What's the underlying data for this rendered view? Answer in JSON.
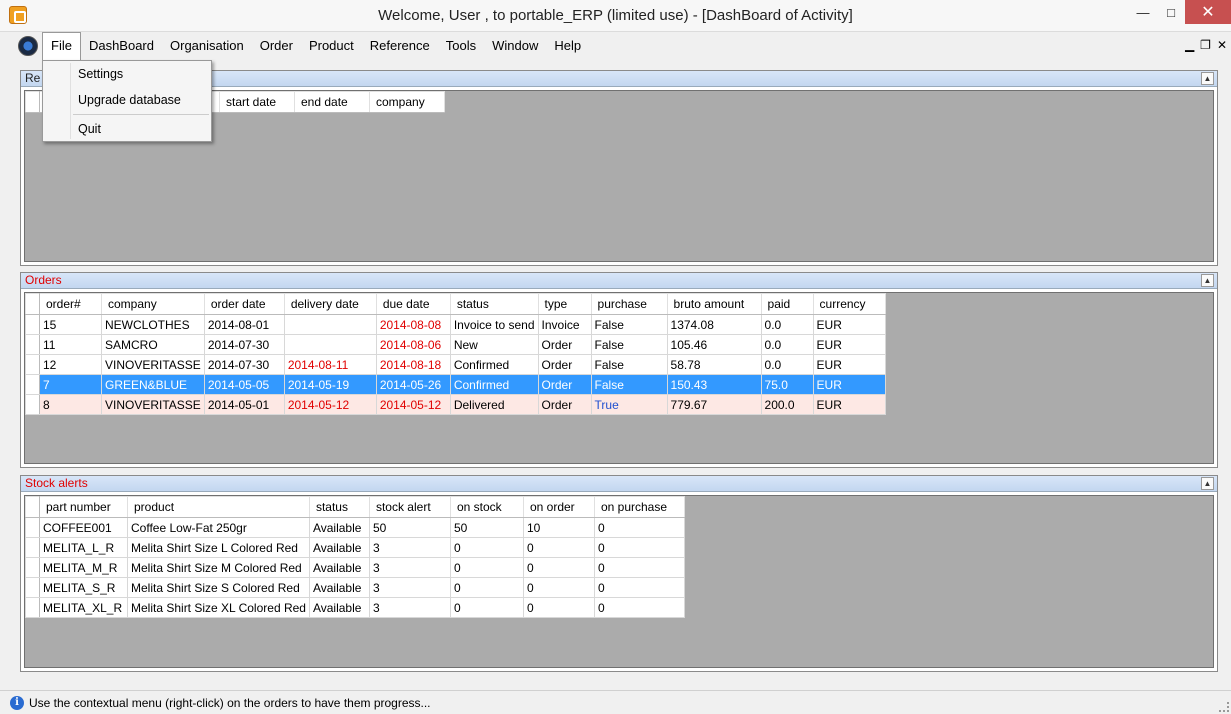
{
  "window": {
    "title": "Welcome, User , to portable_ERP (limited use) - [DashBoard of Activity]",
    "minimize": "—",
    "maximize": "□",
    "close": "✕"
  },
  "menubar": {
    "items": [
      "File",
      "DashBoard",
      "Organisation",
      "Order",
      "Product",
      "Reference",
      "Tools",
      "Window",
      "Help"
    ],
    "mdi_minimize": "▁",
    "mdi_restore": "❐",
    "mdi_close": "✕"
  },
  "file_menu": {
    "items": [
      "Settings",
      "Upgrade database",
      "Quit"
    ]
  },
  "reminders_panel": {
    "title_fragment": "Re",
    "columns": [
      "start date",
      "end date",
      "company"
    ]
  },
  "orders_panel": {
    "title": "Orders",
    "columns": [
      "order#",
      "company",
      "order date",
      "delivery date",
      "due date",
      "status",
      "type",
      "purchase",
      "bruto amount",
      "paid",
      "currency"
    ],
    "rows": [
      {
        "order": "15",
        "company": "NEWCLOTHES",
        "order_date": "2014-08-01",
        "delivery_date": "",
        "due_date": "2014-08-08",
        "status": "Invoice to send",
        "type": "Invoice",
        "purchase": "False",
        "bruto": "1374.08",
        "paid": "0.0",
        "currency": "EUR"
      },
      {
        "order": "11",
        "company": "SAMCRO",
        "order_date": "2014-07-30",
        "delivery_date": "",
        "due_date": "2014-08-06",
        "status": "New",
        "type": "Order",
        "purchase": "False",
        "bruto": "105.46",
        "paid": "0.0",
        "currency": "EUR"
      },
      {
        "order": "12",
        "company": "VINOVERITASSE",
        "order_date": "2014-07-30",
        "delivery_date": "2014-08-11",
        "due_date": "2014-08-18",
        "status": "Confirmed",
        "type": "Order",
        "purchase": "False",
        "bruto": "58.78",
        "paid": "0.0",
        "currency": "EUR"
      },
      {
        "order": "7",
        "company": "GREEN&BLUE",
        "order_date": "2014-05-05",
        "delivery_date": "2014-05-19",
        "due_date": "2014-05-26",
        "status": "Confirmed",
        "type": "Order",
        "purchase": "False",
        "bruto": "150.43",
        "paid": "75.0",
        "currency": "EUR"
      },
      {
        "order": "8",
        "company": "VINOVERITASSE",
        "order_date": "2014-05-01",
        "delivery_date": "2014-05-12",
        "due_date": "2014-05-12",
        "status": "Delivered",
        "type": "Order",
        "purchase": "True",
        "bruto": "779.67",
        "paid": "200.0",
        "currency": "EUR"
      }
    ]
  },
  "stock_panel": {
    "title": "Stock alerts",
    "columns": [
      "part number",
      "product",
      "status",
      "stock alert",
      "on stock",
      "on order",
      "on purchase"
    ],
    "rows": [
      {
        "part": "COFFEE001",
        "product": "Coffee Low-Fat 250gr",
        "status": "Available",
        "alert": "50",
        "stock": "50",
        "order": "10",
        "purchase": "0"
      },
      {
        "part": "MELITA_L_R",
        "product": "Melita Shirt Size L Colored Red",
        "status": "Available",
        "alert": "3",
        "stock": "0",
        "order": "0",
        "purchase": "0"
      },
      {
        "part": "MELITA_M_R",
        "product": "Melita Shirt Size M Colored Red",
        "status": "Available",
        "alert": "3",
        "stock": "0",
        "order": "0",
        "purchase": "0"
      },
      {
        "part": "MELITA_S_R",
        "product": "Melita Shirt Size S Colored Red",
        "status": "Available",
        "alert": "3",
        "stock": "0",
        "order": "0",
        "purchase": "0"
      },
      {
        "part": "MELITA_XL_R",
        "product": "Melita Shirt Size XL Colored Red",
        "status": "Available",
        "alert": "3",
        "stock": "0",
        "order": "0",
        "purchase": "0"
      }
    ]
  },
  "statusbar": {
    "info_glyph": "i",
    "text": "Use the contextual menu (right-click) on the orders to have them progress..."
  },
  "colors": {
    "overdue_red": "#e00000",
    "selection_blue": "#3399ff",
    "true_blue": "#2050d0",
    "panel_gray": "#ababab"
  }
}
